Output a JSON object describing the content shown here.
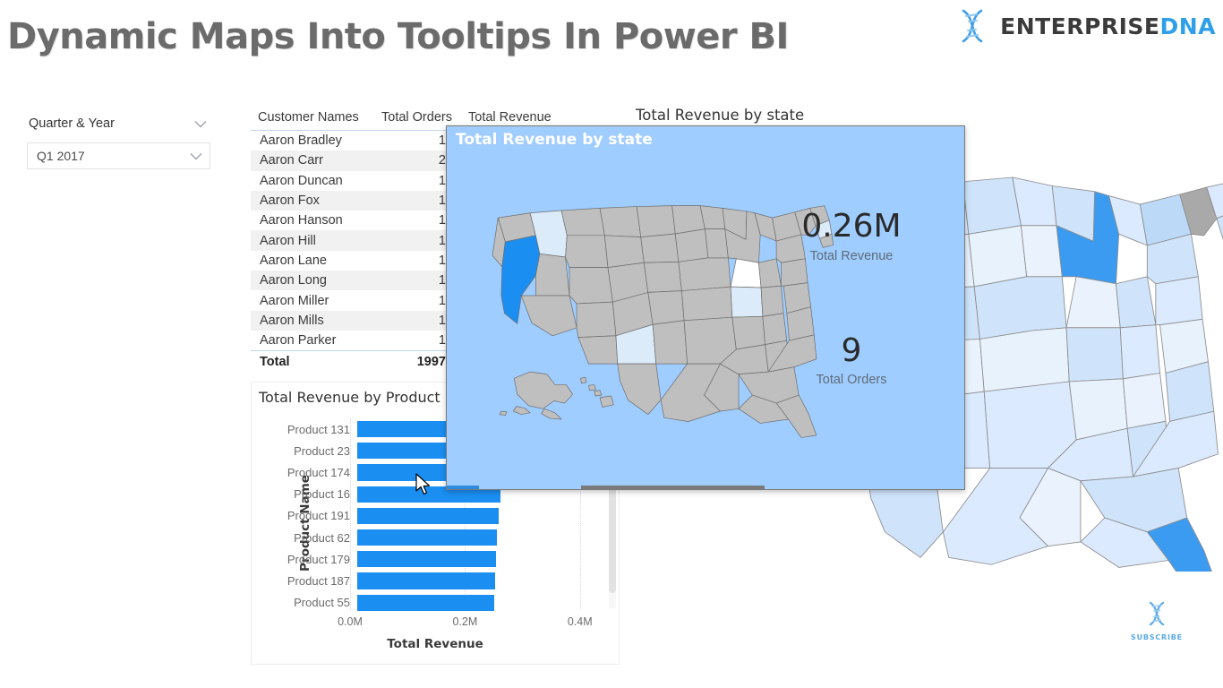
{
  "header": {
    "title": "Dynamic Maps Into Tooltips In Power BI",
    "brand_primary": "ENTERPRISE",
    "brand_secondary": "DNA",
    "logo_icon": "dna-helix-icon"
  },
  "slicer": {
    "label": "Quarter & Year",
    "selected_value": "Q1 2017",
    "expand_icon": "chevron-down-icon"
  },
  "table": {
    "columns": [
      "Customer Names",
      "Total Orders",
      "Total Revenue"
    ],
    "rows": [
      {
        "name": "Aaron Bradley",
        "orders": "1",
        "revenue": ""
      },
      {
        "name": "Aaron Carr",
        "orders": "2",
        "revenue": ""
      },
      {
        "name": "Aaron Duncan",
        "orders": "1",
        "revenue": ""
      },
      {
        "name": "Aaron Fox",
        "orders": "1",
        "revenue": ""
      },
      {
        "name": "Aaron Hanson",
        "orders": "1",
        "revenue": ""
      },
      {
        "name": "Aaron Hill",
        "orders": "1",
        "revenue": ""
      },
      {
        "name": "Aaron Lane",
        "orders": "1",
        "revenue": ""
      },
      {
        "name": "Aaron Long",
        "orders": "1",
        "revenue": ""
      },
      {
        "name": "Aaron Miller",
        "orders": "1",
        "revenue": ""
      },
      {
        "name": "Aaron Mills",
        "orders": "1",
        "revenue": ""
      },
      {
        "name": "Aaron Parker",
        "orders": "1",
        "revenue": ""
      }
    ],
    "total_label": "Total",
    "total_orders": "1997",
    "total_revenue": "",
    "scroll_up_icon": "chevron-up-icon"
  },
  "map_visual": {
    "title": "Total Revenue by state"
  },
  "tooltip": {
    "title": "Total Revenue by state",
    "kpis": [
      {
        "value": "0.26M",
        "label": "Total Revenue"
      },
      {
        "value": "9",
        "label": "Total Orders"
      }
    ],
    "highlight_color": "#1b8ef2",
    "background_color": "#9fcdff"
  },
  "watermark": {
    "label": "SUBSCRIBE",
    "icon": "dna-helix-icon"
  },
  "cursor": {
    "icon": "mouse-pointer-icon"
  },
  "chart_data": {
    "type": "bar",
    "title": "Total Revenue by Product",
    "orientation": "horizontal",
    "categories": [
      "Product 131",
      "Product 23",
      "Product 174",
      "Product 16",
      "Product 191",
      "Product 62",
      "Product 179",
      "Product 187",
      "Product 55"
    ],
    "values": [
      0.272,
      0.268,
      0.262,
      0.256,
      0.254,
      0.25,
      0.248,
      0.247,
      0.246
    ],
    "xlabel": "Total Revenue",
    "ylabel": "Product Name",
    "xticks": [
      "0.0M",
      "0.2M",
      "0.4M"
    ],
    "xtick_values": [
      0.0,
      0.2,
      0.4
    ],
    "xlim": [
      0,
      0.43
    ],
    "grid": true,
    "legend": "none",
    "bar_color": "#1b8ef2"
  }
}
